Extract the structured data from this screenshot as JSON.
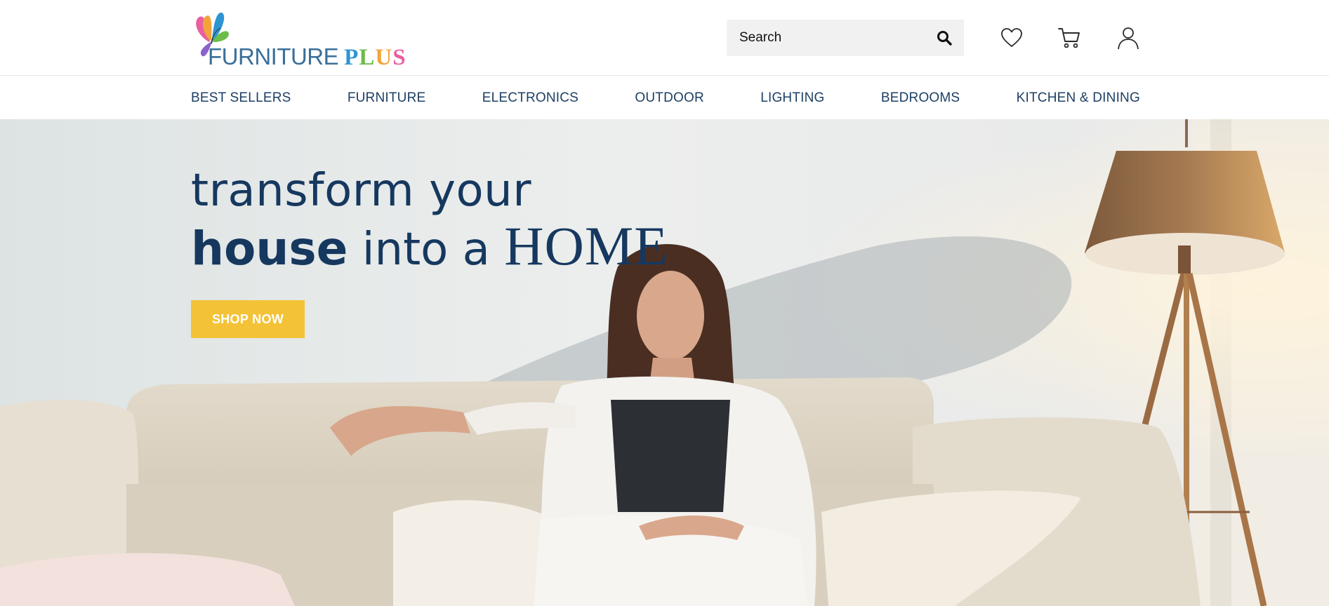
{
  "brand": {
    "name_part1": "FURNITURE",
    "name_part2_letters": [
      "P",
      "L",
      "U",
      "S"
    ]
  },
  "search": {
    "placeholder": "Search",
    "icon": "search-icon"
  },
  "header_icons": {
    "wishlist": "heart-icon",
    "cart": "cart-icon",
    "account": "user-icon"
  },
  "nav": {
    "items": [
      {
        "label": "BEST SELLERS"
      },
      {
        "label": "FURNITURE"
      },
      {
        "label": "ELECTRONICS"
      },
      {
        "label": "OUTDOOR"
      },
      {
        "label": "LIGHTING"
      },
      {
        "label": "BEDROOMS"
      },
      {
        "label": "KITCHEN & DINING"
      }
    ]
  },
  "hero": {
    "line1": "transform your",
    "line2_bold": "house",
    "line2_mid": " into a ",
    "line2_serif": "HOME",
    "cta_label": "SHOP NOW"
  },
  "colors": {
    "primary_text": "#1d3f63",
    "cta": "#f4c236",
    "search_bg": "#f1f1f1"
  }
}
